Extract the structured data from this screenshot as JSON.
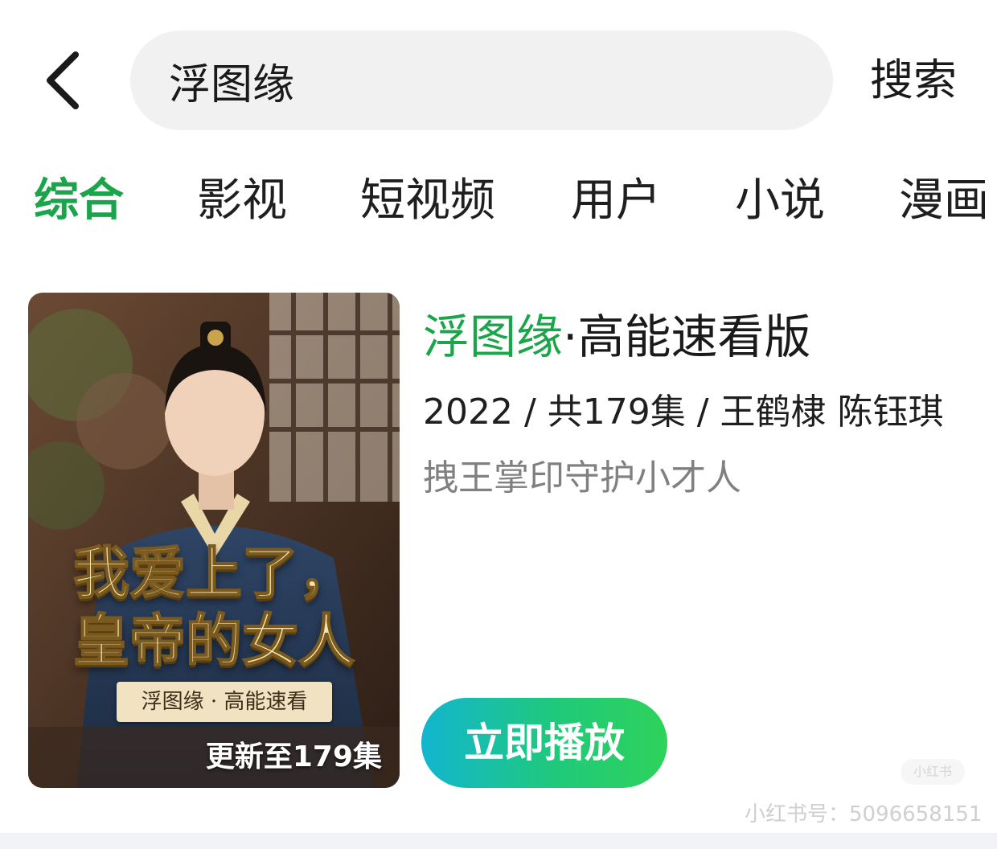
{
  "colors": {
    "accent_green": "#1aa54a",
    "text_primary": "#1a1a1a",
    "text_secondary": "#808080",
    "search_bg": "#f1f1f1",
    "play_gradient_start": "#11b6cf",
    "play_gradient_end": "#2ed35a"
  },
  "header": {
    "back_icon": "chevron-left-icon",
    "search_value": "浮图缘",
    "search_button": "搜索"
  },
  "tabs": [
    {
      "label": "综合",
      "active": true
    },
    {
      "label": "影视",
      "active": false
    },
    {
      "label": "短视频",
      "active": false
    },
    {
      "label": "用户",
      "active": false
    },
    {
      "label": "小说",
      "active": false
    },
    {
      "label": "漫画",
      "active": false
    }
  ],
  "result": {
    "title_highlight": "浮图缘",
    "title_rest": "·高能速看版",
    "meta": "2022 / 共179集 / 王鹤棣 陈钰琪",
    "description": "拽王掌印守护小才人",
    "poster": {
      "title_line1": "我爱上了，",
      "title_line2": "皇帝的女人",
      "ribbon": "浮图缘 · 高能速看",
      "badge": "更新至179集"
    },
    "play_button": "立即播放"
  },
  "watermark": {
    "text": "小红书号：5096658151",
    "logo_text": "小红书"
  }
}
